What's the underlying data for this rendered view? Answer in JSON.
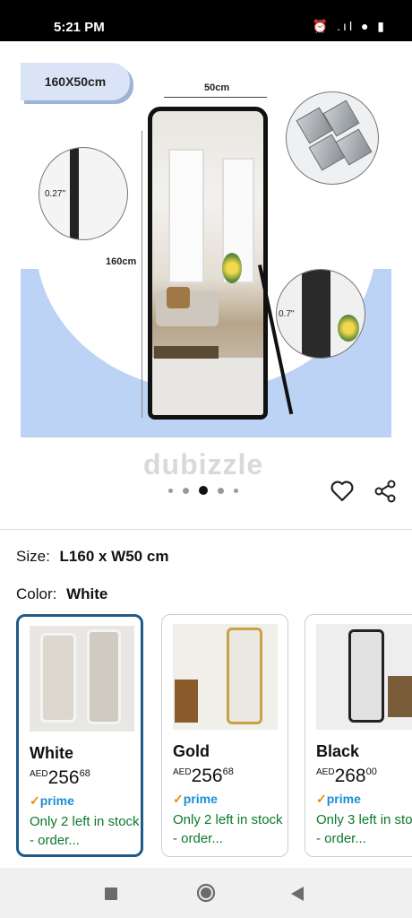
{
  "status_bar": {
    "time": "5:21 PM",
    "icons": "⏰ .ıl ● ▮"
  },
  "hero": {
    "size_tag": "160X50cm",
    "width_label": "50cm",
    "height_label": "160cm",
    "thickness_label_1": "0.27''",
    "thickness_label_2": "0.7''",
    "watermark": "dubizzle",
    "dots_count": 5,
    "active_dot": 2
  },
  "product": {
    "size_label": "Size:",
    "size_value": "L160 x W50 cm",
    "color_label": "Color:",
    "color_value": "White"
  },
  "variants": [
    {
      "name": "White",
      "currency": "AED",
      "price_whole": "256",
      "price_frac": "68",
      "prime": "prime",
      "stock": "Only 2 left in stock - order...",
      "frame_color": "#f4f4f4"
    },
    {
      "name": "Gold",
      "currency": "AED",
      "price_whole": "256",
      "price_frac": "68",
      "prime": "prime",
      "stock": "Only 2 left in stock - order...",
      "frame_color": "#c9a14a"
    },
    {
      "name": "Black",
      "currency": "AED",
      "price_whole": "268",
      "price_frac": "00",
      "prime": "prime",
      "stock": "Only 3 left in stock - order...",
      "frame_color": "#222222"
    }
  ],
  "colors": {
    "accent": "#1e5b8a",
    "stock_green": "#0a7a2a",
    "prime_blue": "#1a8fd6",
    "hero_blue": "#bcd3f5"
  }
}
